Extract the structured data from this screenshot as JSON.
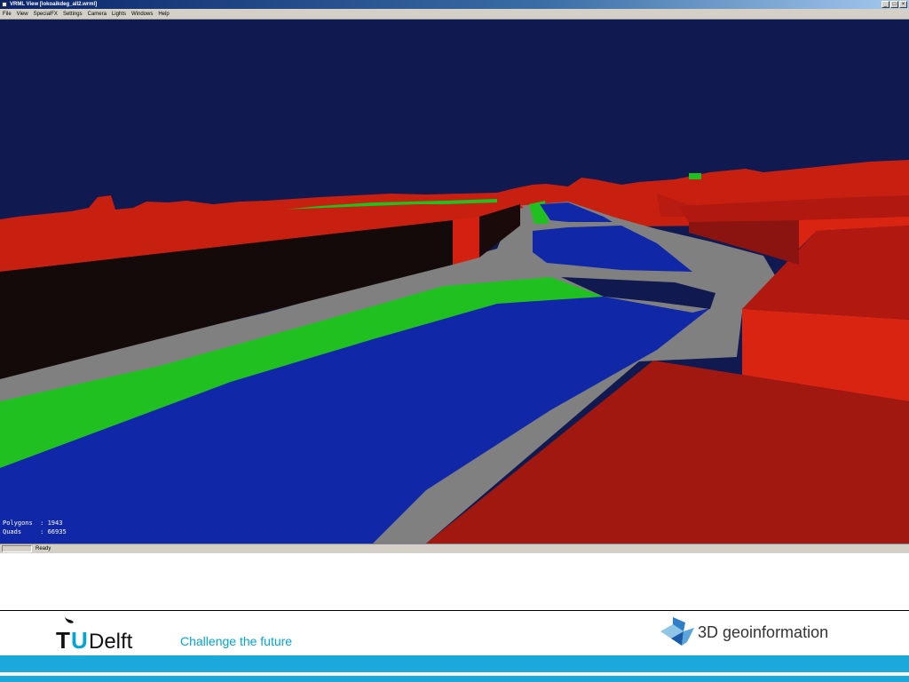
{
  "window": {
    "title": "VRML View [lokoaikdeg_all2.wrml]",
    "buttons": [
      "_",
      "□",
      "×"
    ]
  },
  "menu": [
    "File",
    "View",
    "SpecialFX",
    "Settings",
    "Camera",
    "Lights",
    "Windows",
    "Help"
  ],
  "stats": {
    "polygons_label": "Polygons",
    "polygons_value": "1943",
    "quads_label": "Quads",
    "quads_value": "66935"
  },
  "status": {
    "text": "Ready"
  },
  "footer": {
    "logo_text": "TUDelft",
    "slogan": "Challenge the future",
    "brand": "3D geoinformation"
  },
  "colors": {
    "sky": "#101a50",
    "building": "#cc2010",
    "water": "#1028a8",
    "road": "#808080",
    "grass": "#20c020",
    "accent": "#1ba9dc"
  }
}
